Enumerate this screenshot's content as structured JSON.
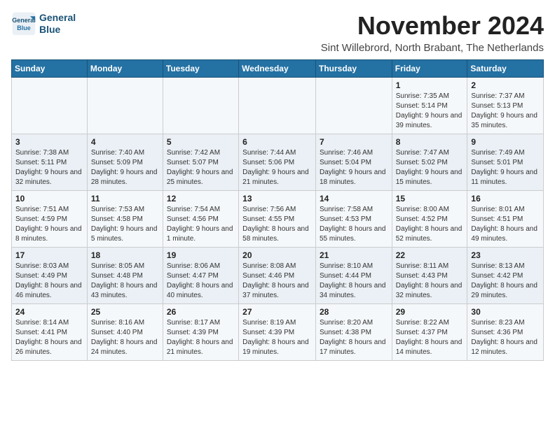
{
  "logo": {
    "line1": "General",
    "line2": "Blue"
  },
  "title": "November 2024",
  "location": "Sint Willebrord, North Brabant, The Netherlands",
  "weekdays": [
    "Sunday",
    "Monday",
    "Tuesday",
    "Wednesday",
    "Thursday",
    "Friday",
    "Saturday"
  ],
  "weeks": [
    [
      {
        "day": "",
        "info": ""
      },
      {
        "day": "",
        "info": ""
      },
      {
        "day": "",
        "info": ""
      },
      {
        "day": "",
        "info": ""
      },
      {
        "day": "",
        "info": ""
      },
      {
        "day": "1",
        "info": "Sunrise: 7:35 AM\nSunset: 5:14 PM\nDaylight: 9 hours and 39 minutes."
      },
      {
        "day": "2",
        "info": "Sunrise: 7:37 AM\nSunset: 5:13 PM\nDaylight: 9 hours and 35 minutes."
      }
    ],
    [
      {
        "day": "3",
        "info": "Sunrise: 7:38 AM\nSunset: 5:11 PM\nDaylight: 9 hours and 32 minutes."
      },
      {
        "day": "4",
        "info": "Sunrise: 7:40 AM\nSunset: 5:09 PM\nDaylight: 9 hours and 28 minutes."
      },
      {
        "day": "5",
        "info": "Sunrise: 7:42 AM\nSunset: 5:07 PM\nDaylight: 9 hours and 25 minutes."
      },
      {
        "day": "6",
        "info": "Sunrise: 7:44 AM\nSunset: 5:06 PM\nDaylight: 9 hours and 21 minutes."
      },
      {
        "day": "7",
        "info": "Sunrise: 7:46 AM\nSunset: 5:04 PM\nDaylight: 9 hours and 18 minutes."
      },
      {
        "day": "8",
        "info": "Sunrise: 7:47 AM\nSunset: 5:02 PM\nDaylight: 9 hours and 15 minutes."
      },
      {
        "day": "9",
        "info": "Sunrise: 7:49 AM\nSunset: 5:01 PM\nDaylight: 9 hours and 11 minutes."
      }
    ],
    [
      {
        "day": "10",
        "info": "Sunrise: 7:51 AM\nSunset: 4:59 PM\nDaylight: 9 hours and 8 minutes."
      },
      {
        "day": "11",
        "info": "Sunrise: 7:53 AM\nSunset: 4:58 PM\nDaylight: 9 hours and 5 minutes."
      },
      {
        "day": "12",
        "info": "Sunrise: 7:54 AM\nSunset: 4:56 PM\nDaylight: 9 hours and 1 minute."
      },
      {
        "day": "13",
        "info": "Sunrise: 7:56 AM\nSunset: 4:55 PM\nDaylight: 8 hours and 58 minutes."
      },
      {
        "day": "14",
        "info": "Sunrise: 7:58 AM\nSunset: 4:53 PM\nDaylight: 8 hours and 55 minutes."
      },
      {
        "day": "15",
        "info": "Sunrise: 8:00 AM\nSunset: 4:52 PM\nDaylight: 8 hours and 52 minutes."
      },
      {
        "day": "16",
        "info": "Sunrise: 8:01 AM\nSunset: 4:51 PM\nDaylight: 8 hours and 49 minutes."
      }
    ],
    [
      {
        "day": "17",
        "info": "Sunrise: 8:03 AM\nSunset: 4:49 PM\nDaylight: 8 hours and 46 minutes."
      },
      {
        "day": "18",
        "info": "Sunrise: 8:05 AM\nSunset: 4:48 PM\nDaylight: 8 hours and 43 minutes."
      },
      {
        "day": "19",
        "info": "Sunrise: 8:06 AM\nSunset: 4:47 PM\nDaylight: 8 hours and 40 minutes."
      },
      {
        "day": "20",
        "info": "Sunrise: 8:08 AM\nSunset: 4:46 PM\nDaylight: 8 hours and 37 minutes."
      },
      {
        "day": "21",
        "info": "Sunrise: 8:10 AM\nSunset: 4:44 PM\nDaylight: 8 hours and 34 minutes."
      },
      {
        "day": "22",
        "info": "Sunrise: 8:11 AM\nSunset: 4:43 PM\nDaylight: 8 hours and 32 minutes."
      },
      {
        "day": "23",
        "info": "Sunrise: 8:13 AM\nSunset: 4:42 PM\nDaylight: 8 hours and 29 minutes."
      }
    ],
    [
      {
        "day": "24",
        "info": "Sunrise: 8:14 AM\nSunset: 4:41 PM\nDaylight: 8 hours and 26 minutes."
      },
      {
        "day": "25",
        "info": "Sunrise: 8:16 AM\nSunset: 4:40 PM\nDaylight: 8 hours and 24 minutes."
      },
      {
        "day": "26",
        "info": "Sunrise: 8:17 AM\nSunset: 4:39 PM\nDaylight: 8 hours and 21 minutes."
      },
      {
        "day": "27",
        "info": "Sunrise: 8:19 AM\nSunset: 4:39 PM\nDaylight: 8 hours and 19 minutes."
      },
      {
        "day": "28",
        "info": "Sunrise: 8:20 AM\nSunset: 4:38 PM\nDaylight: 8 hours and 17 minutes."
      },
      {
        "day": "29",
        "info": "Sunrise: 8:22 AM\nSunset: 4:37 PM\nDaylight: 8 hours and 14 minutes."
      },
      {
        "day": "30",
        "info": "Sunrise: 8:23 AM\nSunset: 4:36 PM\nDaylight: 8 hours and 12 minutes."
      }
    ]
  ]
}
